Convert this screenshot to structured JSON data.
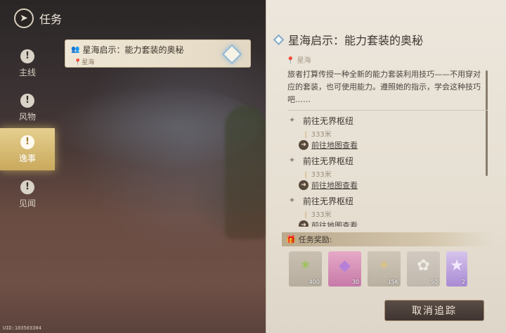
{
  "header": {
    "title": "任务",
    "back_icon": "compass-back-icon"
  },
  "sidebar": {
    "items": [
      {
        "label": "主线",
        "icon": "exclamation-icon",
        "active": false
      },
      {
        "label": "风物",
        "icon": "exclamation-icon",
        "active": false
      },
      {
        "label": "逸事",
        "icon": "exclamation-icon",
        "active": true
      },
      {
        "label": "见闻",
        "icon": "exclamation-icon",
        "active": false
      }
    ]
  },
  "quest_card": {
    "title": "星海启示：能力套装的奥秘",
    "location": "星海",
    "tracking_icon": "diamond-tracking-icon"
  },
  "panel": {
    "title": "星海启示：能力套装的奥秘",
    "location": "星海",
    "description": "旅者打算传授一种全新的能力套装利用技巧——不用穿对应的套装，也可使用能力。遵照她的指示，学会这种技巧吧……",
    "steps": [
      {
        "title": "前往无界枢纽",
        "distance": "333米",
        "link": "前往地图查看"
      },
      {
        "title": "前往无界枢纽",
        "distance": "333米",
        "link": "前往地图查看"
      },
      {
        "title": "前往无界枢纽",
        "distance": "333米",
        "link": "前往地图查看"
      }
    ],
    "reward_label": "任务奖励:",
    "rewards": [
      {
        "icon": "green-star-crystal-icon",
        "count": "400"
      },
      {
        "icon": "pink-gem-icon",
        "count": "30"
      },
      {
        "icon": "gold-star-icon",
        "count": "15K"
      },
      {
        "icon": "ribbon-bow-icon",
        "count": "50"
      },
      {
        "icon": "purple-star-icon",
        "count": "2"
      }
    ],
    "cancel_label": "取消追踪"
  },
  "uid": "UID:103503304"
}
